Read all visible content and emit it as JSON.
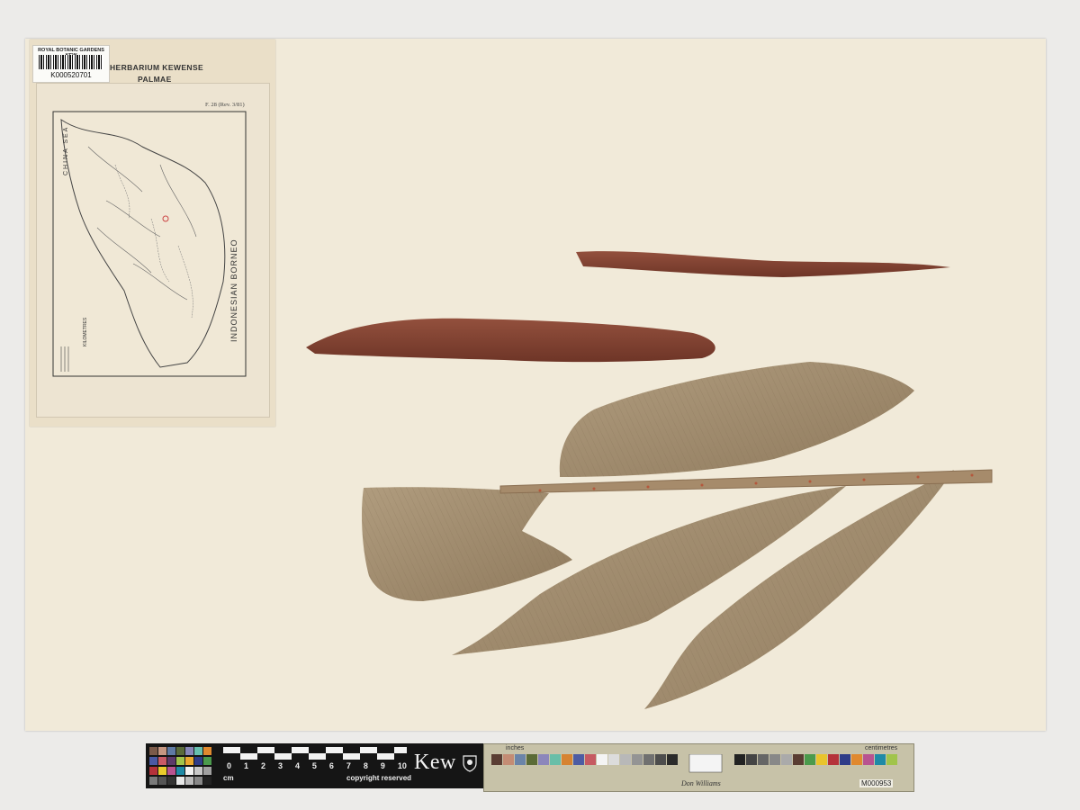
{
  "label": {
    "institution": "ROYAL BOTANIC GARDENS KEW",
    "barcode": "K000520701",
    "herbarium": "HERBARIUM KEWENSE",
    "family": "PALMAE",
    "form_code": "F. 28 (Rev. 3/81)"
  },
  "map": {
    "sea_label": "CHINA SEA",
    "region_label": "INDONESIAN BORNEO",
    "legend_title": "KILOMETRES"
  },
  "scale": {
    "unit": "cm",
    "numbers": [
      "0",
      "1",
      "2",
      "3",
      "4",
      "5",
      "6",
      "7",
      "8",
      "9",
      "10"
    ],
    "copyright": "copyright reserved",
    "brand": "Kew",
    "inches": "inches",
    "centimetres": "centimetres",
    "signature": "Don Williams",
    "target_id": "M000953"
  },
  "colors": {
    "sheet": "#f1ead9",
    "leaf": "#9e8a6e",
    "stem": "#7c3a2b"
  }
}
